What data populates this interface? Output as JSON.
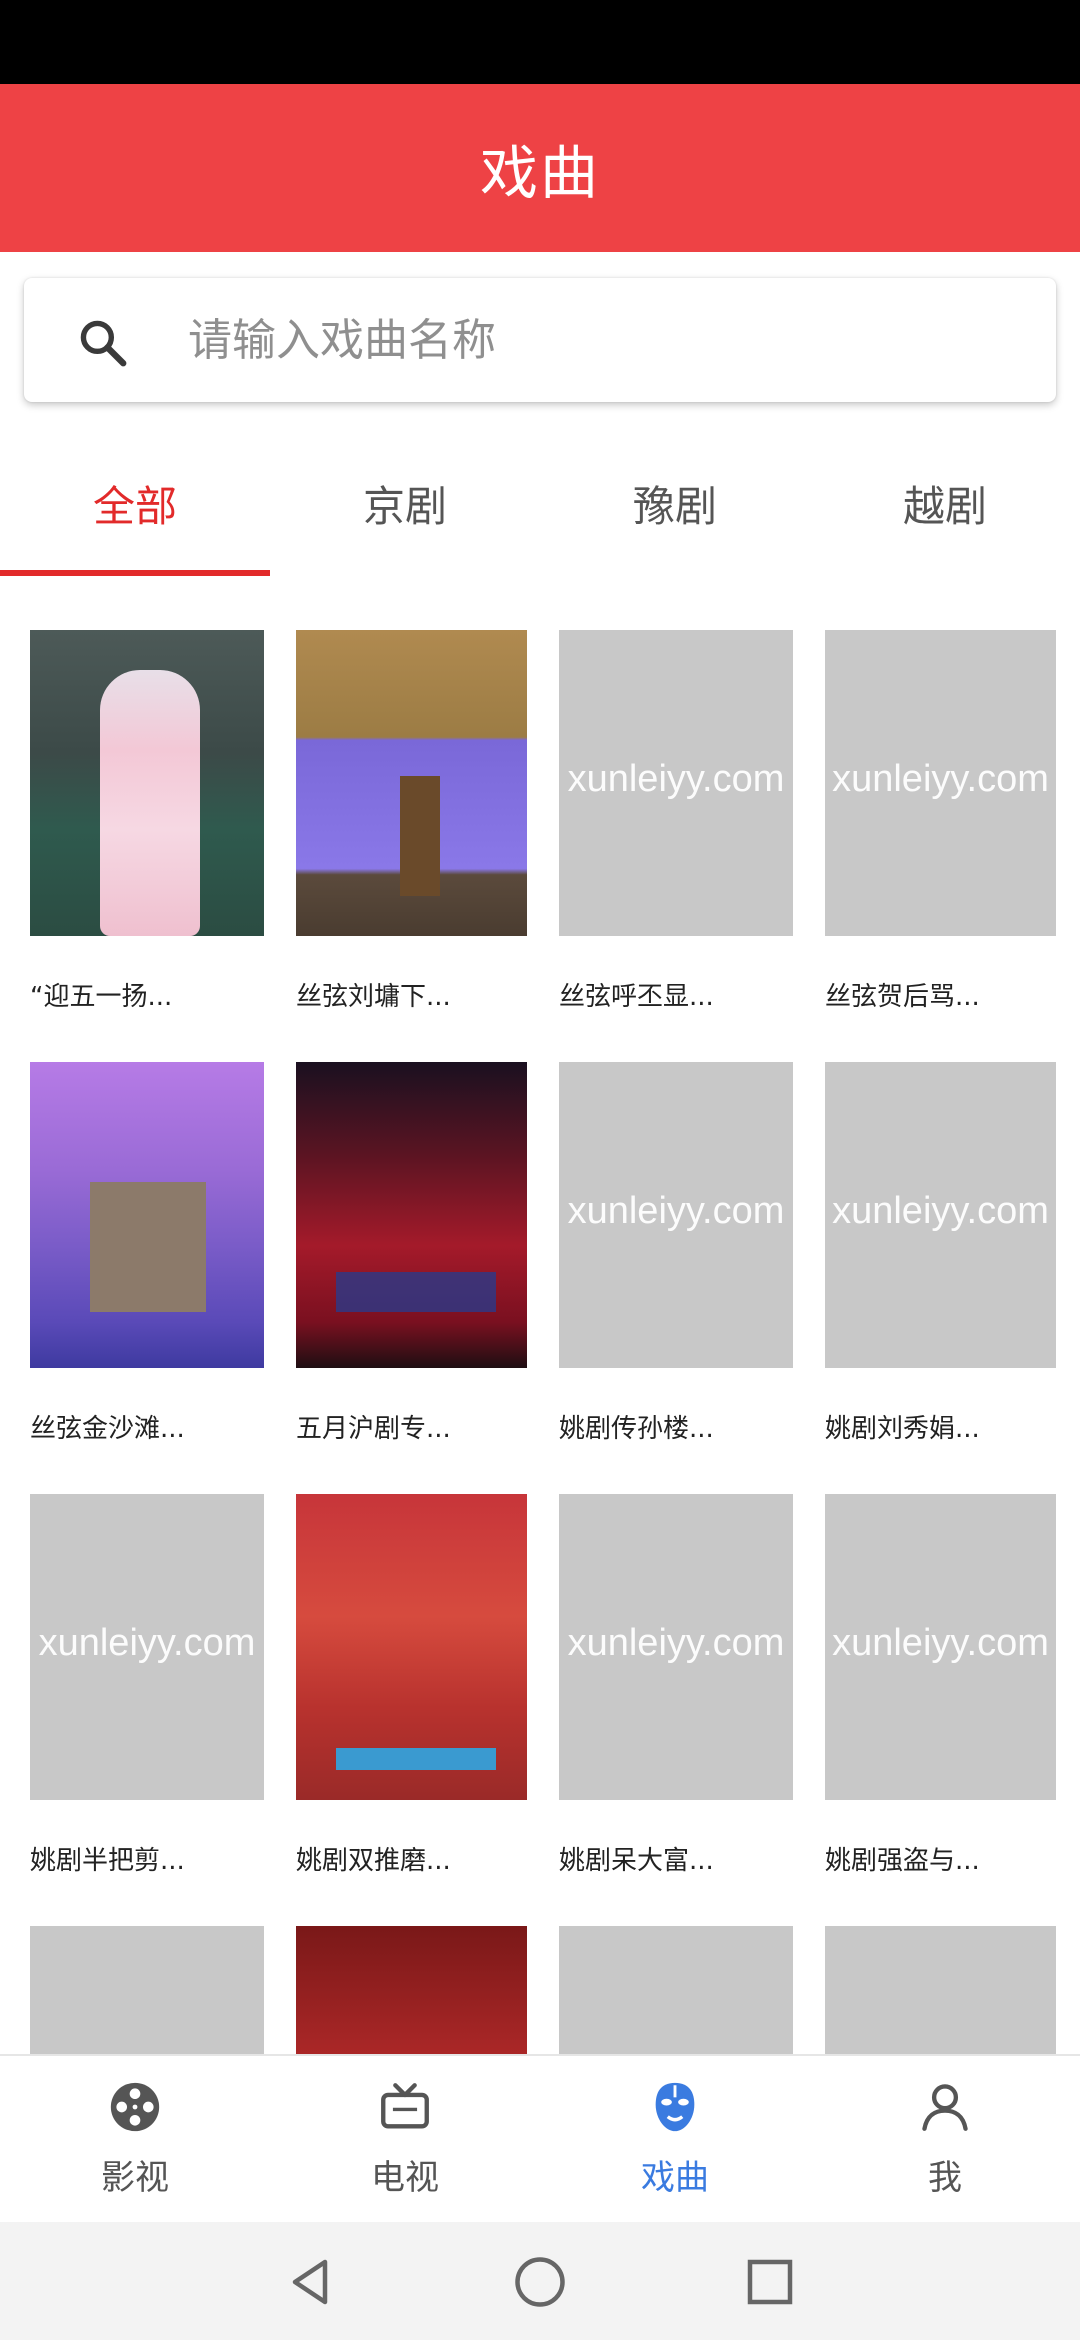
{
  "header": {
    "title": "戏曲"
  },
  "search": {
    "placeholder": "请输入戏曲名称",
    "value": ""
  },
  "tabs": [
    {
      "label": "全部",
      "active": true
    },
    {
      "label": "京剧",
      "active": false
    },
    {
      "label": "豫剧",
      "active": false
    },
    {
      "label": "越剧",
      "active": false
    }
  ],
  "grid": {
    "watermark": "xunleiyy.com",
    "items": [
      {
        "title": "“迎五一扬...",
        "thumb": "photo"
      },
      {
        "title": "丝弦刘墉下...",
        "thumb": "photo"
      },
      {
        "title": "丝弦呼丕显...",
        "thumb": "placeholder"
      },
      {
        "title": "丝弦贺后骂...",
        "thumb": "placeholder"
      },
      {
        "title": "丝弦金沙滩...",
        "thumb": "photo"
      },
      {
        "title": "五月沪剧专...",
        "thumb": "photo"
      },
      {
        "title": "姚剧传孙楼...",
        "thumb": "placeholder"
      },
      {
        "title": "姚剧刘秀娟...",
        "thumb": "placeholder"
      },
      {
        "title": "姚剧半把剪...",
        "thumb": "placeholder"
      },
      {
        "title": "姚剧双推磨...",
        "thumb": "photo"
      },
      {
        "title": "姚剧呆大富...",
        "thumb": "placeholder"
      },
      {
        "title": "姚剧强盗与...",
        "thumb": "placeholder"
      },
      {
        "title": "",
        "thumb": "placeholder"
      },
      {
        "title": "",
        "thumb": "photo"
      },
      {
        "title": "",
        "thumb": "placeholder"
      },
      {
        "title": "",
        "thumb": "placeholder"
      }
    ]
  },
  "bottom_nav": [
    {
      "label": "影视",
      "icon": "film-reel-icon",
      "active": false
    },
    {
      "label": "电视",
      "icon": "tv-icon",
      "active": false
    },
    {
      "label": "戏曲",
      "icon": "opera-mask-icon",
      "active": true
    },
    {
      "label": "我",
      "icon": "person-icon",
      "active": false
    }
  ],
  "colors": {
    "header": "#ee4245",
    "tab_active": "#e22a2a",
    "nav_active": "#3a7be0",
    "placeholder_thumb": "#c8c8c8"
  }
}
